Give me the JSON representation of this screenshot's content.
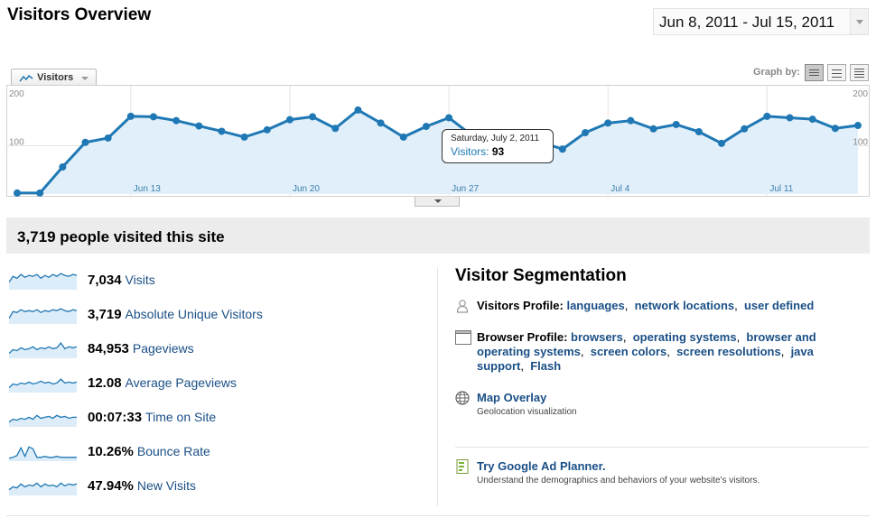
{
  "header": {
    "title": "Visitors Overview",
    "date_range": "Jun 8, 2011 - Jul 15, 2011"
  },
  "chart_controls": {
    "metric_tab": "Visitors",
    "graph_by_label": "Graph by:",
    "graph_by_options": [
      "day-icon",
      "week-icon",
      "month-icon"
    ]
  },
  "chart_data": {
    "type": "area",
    "title": "",
    "x_tick_labels": [
      "Jun 13",
      "Jun 20",
      "Jun 27",
      "Jul 4",
      "Jul 11"
    ],
    "y_tick_labels": [
      "200",
      "100"
    ],
    "ylim": [
      0,
      200
    ],
    "series": [
      {
        "name": "Visitors",
        "color": "#1f78b4",
        "x": [
          "Jun 8",
          "Jun 9",
          "Jun 10",
          "Jun 11",
          "Jun 12",
          "Jun 13",
          "Jun 14",
          "Jun 15",
          "Jun 16",
          "Jun 17",
          "Jun 18",
          "Jun 19",
          "Jun 20",
          "Jun 21",
          "Jun 22",
          "Jun 23",
          "Jun 24",
          "Jun 25",
          "Jun 26",
          "Jun 27",
          "Jun 28",
          "Jun 29",
          "Jun 30",
          "Jul 1",
          "Jul 2",
          "Jul 3",
          "Jul 4",
          "Jul 5",
          "Jul 6",
          "Jul 7",
          "Jul 8",
          "Jul 9",
          "Jul 10",
          "Jul 11",
          "Jul 12",
          "Jul 13",
          "Jul 14",
          "Jul 15"
        ],
        "values": [
          2,
          2,
          56,
          107,
          116,
          161,
          160,
          152,
          141,
          130,
          118,
          133,
          154,
          160,
          136,
          174,
          147,
          118,
          140,
          158,
          122,
          109,
          103,
          108,
          93,
          127,
          147,
          152,
          135,
          144,
          129,
          105,
          135,
          161,
          158,
          155,
          136,
          142
        ]
      }
    ],
    "tooltip": {
      "date": "Saturday, July 2, 2011",
      "metric": "Visitors:",
      "value": "93"
    },
    "grid": true
  },
  "summary": {
    "text": "3,719 people visited this site"
  },
  "stats": [
    {
      "value": "7,034",
      "label": "Visits",
      "spark": [
        8,
        14,
        12,
        16,
        13,
        15,
        14,
        16,
        12,
        15,
        13,
        16,
        14,
        17,
        15,
        14,
        16,
        15
      ]
    },
    {
      "value": "3,719",
      "label": "Absolute Unique Visitors",
      "spark": [
        6,
        13,
        12,
        15,
        13,
        14,
        13,
        15,
        12,
        14,
        13,
        15,
        14,
        16,
        14,
        13,
        15,
        14
      ]
    },
    {
      "value": "84,953",
      "label": "Pageviews",
      "spark": [
        5,
        9,
        8,
        11,
        9,
        10,
        12,
        9,
        11,
        10,
        12,
        10,
        11,
        16,
        10,
        12,
        11,
        12
      ]
    },
    {
      "value": "12.08",
      "label": "Average Pageviews",
      "spark": [
        5,
        9,
        8,
        10,
        9,
        11,
        9,
        10,
        12,
        10,
        11,
        9,
        10,
        14,
        10,
        11,
        10,
        11
      ]
    },
    {
      "value": "00:07:33",
      "label": "Time on Site",
      "spark": [
        5,
        8,
        7,
        9,
        8,
        10,
        8,
        12,
        9,
        10,
        11,
        9,
        12,
        10,
        11,
        9,
        10,
        10
      ]
    },
    {
      "value": "10.26%",
      "label": "Bounce Rate",
      "spark": [
        3,
        4,
        6,
        14,
        5,
        15,
        13,
        4,
        4,
        5,
        4,
        4,
        5,
        4,
        4,
        4,
        4,
        4
      ]
    },
    {
      "value": "47.94%",
      "label": "New Visits",
      "spark": [
        6,
        9,
        8,
        12,
        9,
        11,
        10,
        13,
        9,
        12,
        10,
        11,
        9,
        13,
        10,
        12,
        11,
        12
      ]
    }
  ],
  "segmentation": {
    "title": "Visitor Segmentation",
    "visitors_profile": {
      "label": "Visitors Profile:",
      "links": [
        "languages",
        "network locations",
        "user defined"
      ]
    },
    "browser_profile": {
      "label": "Browser Profile:",
      "links": [
        "browsers",
        "operating systems",
        "browser and operating systems",
        "screen colors",
        "screen resolutions",
        "java support",
        "Flash"
      ]
    },
    "map_overlay": {
      "label": "Map Overlay",
      "sub": "Geolocation visualization"
    },
    "ad_planner": {
      "label": "Try Google Ad Planner.",
      "sub": "Understand the demographics and behaviors of your website's visitors."
    }
  }
}
